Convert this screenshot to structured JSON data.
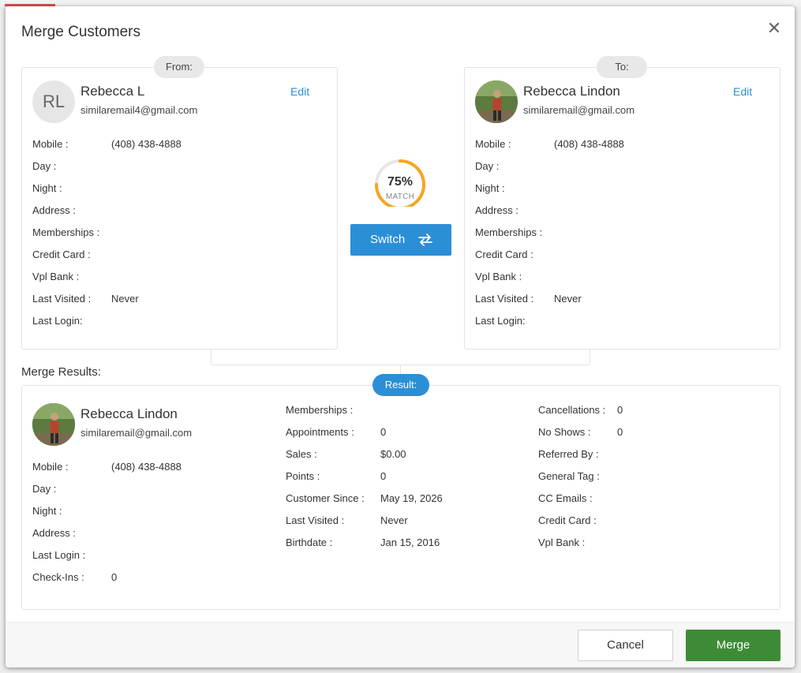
{
  "dialog": {
    "title": "Merge Customers",
    "close_icon": "close-icon"
  },
  "from": {
    "pill": "From:",
    "initials": "RL",
    "name": "Rebecca L",
    "email": "similaremail4@gmail.com",
    "edit_label": "Edit",
    "fields": [
      {
        "label": "Mobile :",
        "value": "(408) 438-4888"
      },
      {
        "label": "Day :",
        "value": ""
      },
      {
        "label": "Night :",
        "value": ""
      },
      {
        "label": "Address :",
        "value": ""
      },
      {
        "label": "Memberships :",
        "value": ""
      },
      {
        "label": "Credit Card :",
        "value": ""
      },
      {
        "label": "Vpl Bank :",
        "value": ""
      },
      {
        "label": "Last Visited :",
        "value": "Never"
      },
      {
        "label": "Last Login:",
        "value": ""
      }
    ]
  },
  "to": {
    "pill": "To:",
    "name": "Rebecca Lindon",
    "email": "similaremail@gmail.com",
    "edit_label": "Edit",
    "fields": [
      {
        "label": "Mobile :",
        "value": "(408) 438-4888"
      },
      {
        "label": "Day :",
        "value": ""
      },
      {
        "label": "Night :",
        "value": ""
      },
      {
        "label": "Address :",
        "value": ""
      },
      {
        "label": "Memberships :",
        "value": ""
      },
      {
        "label": "Credit Card :",
        "value": ""
      },
      {
        "label": "Vpl Bank :",
        "value": ""
      },
      {
        "label": "Last Visited :",
        "value": "Never"
      },
      {
        "label": "Last Login:",
        "value": ""
      }
    ]
  },
  "match": {
    "percent": 75,
    "percent_text": "75%",
    "label": "MATCH",
    "color": "#f5a623"
  },
  "switch_button": {
    "label": "Switch",
    "icon": "swap-arrows-icon"
  },
  "results": {
    "section_label": "Merge Results:",
    "pill": "Result:",
    "name": "Rebecca Lindon",
    "email": "similaremail@gmail.com",
    "col1": [
      {
        "label": "Mobile :",
        "value": "(408) 438-4888"
      },
      {
        "label": "Day :",
        "value": ""
      },
      {
        "label": "Night :",
        "value": ""
      },
      {
        "label": "Address :",
        "value": ""
      },
      {
        "label": "Last Login :",
        "value": ""
      },
      {
        "label": "Check-Ins :",
        "value": "0"
      }
    ],
    "col2": [
      {
        "label": "Memberships :",
        "value": ""
      },
      {
        "label": "Appointments :",
        "value": "0"
      },
      {
        "label": "Sales :",
        "value": "$0.00"
      },
      {
        "label": "Points :",
        "value": "0"
      },
      {
        "label": "Customer Since :",
        "value": "May 19, 2026"
      },
      {
        "label": "Last Visited :",
        "value": "Never"
      },
      {
        "label": "Birthdate :",
        "value": "Jan 15, 2016"
      }
    ],
    "col3": [
      {
        "label": "Cancellations :",
        "value": "0"
      },
      {
        "label": "No Shows :",
        "value": "0"
      },
      {
        "label": "Referred By :",
        "value": ""
      },
      {
        "label": "General Tag :",
        "value": ""
      },
      {
        "label": "CC Emails :",
        "value": ""
      },
      {
        "label": "Credit Card :",
        "value": ""
      },
      {
        "label": "Vpl Bank :",
        "value": ""
      }
    ]
  },
  "footer": {
    "cancel_label": "Cancel",
    "merge_label": "Merge"
  },
  "colors": {
    "accent": "#2b8fd6",
    "merge": "#3d8b37"
  }
}
